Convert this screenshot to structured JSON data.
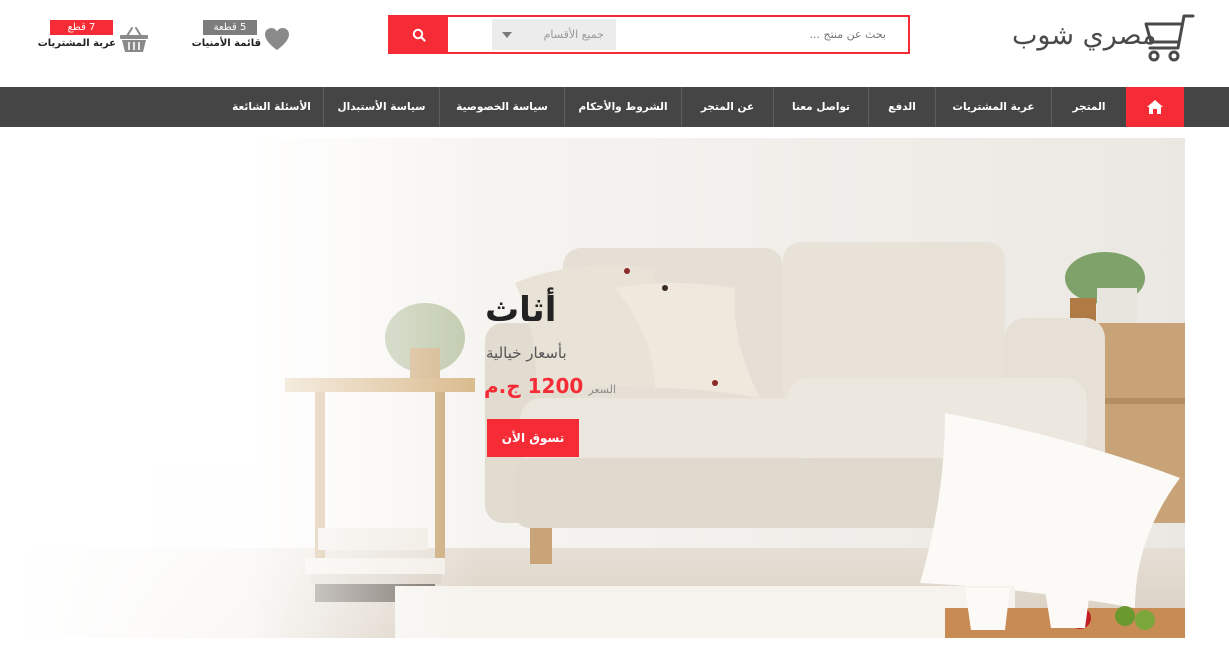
{
  "header": {
    "logo_text": "مصري شوب",
    "search": {
      "placeholder": "بحث عن منتج ...",
      "category_label": "جميع الأقسام"
    },
    "wishlist": {
      "count_label": "5 قطعة",
      "label": "قائمة الأمنيات"
    },
    "cart": {
      "count_label": "7 قطع",
      "label": "عربة المشتريات"
    }
  },
  "nav": {
    "items": [
      {
        "label": "المتجر"
      },
      {
        "label": "عربة المشتريات"
      },
      {
        "label": "الدفع"
      },
      {
        "label": "تواصل معنا"
      },
      {
        "label": "عن المتجر"
      },
      {
        "label": "الشروط والأحكام"
      },
      {
        "label": "سياسة الخصوصية"
      },
      {
        "label": "سياسة الأستبدال"
      },
      {
        "label": "الأسئلة الشائعة"
      }
    ]
  },
  "hero": {
    "title": "أثاث",
    "subtitle": "بأسعار خيالية",
    "price_label": "السعر",
    "price_value": "1200 ج.م",
    "cta_label": "تسوق الأن"
  },
  "icons": {
    "logo": "shopping-cart-icon",
    "search": "search-icon",
    "wishlist": "heart-icon",
    "cart": "basket-icon",
    "home": "home-icon"
  },
  "colors": {
    "accent": "#f52b36",
    "nav_bg": "#454545",
    "badge_gray": "#7d7d7d"
  }
}
